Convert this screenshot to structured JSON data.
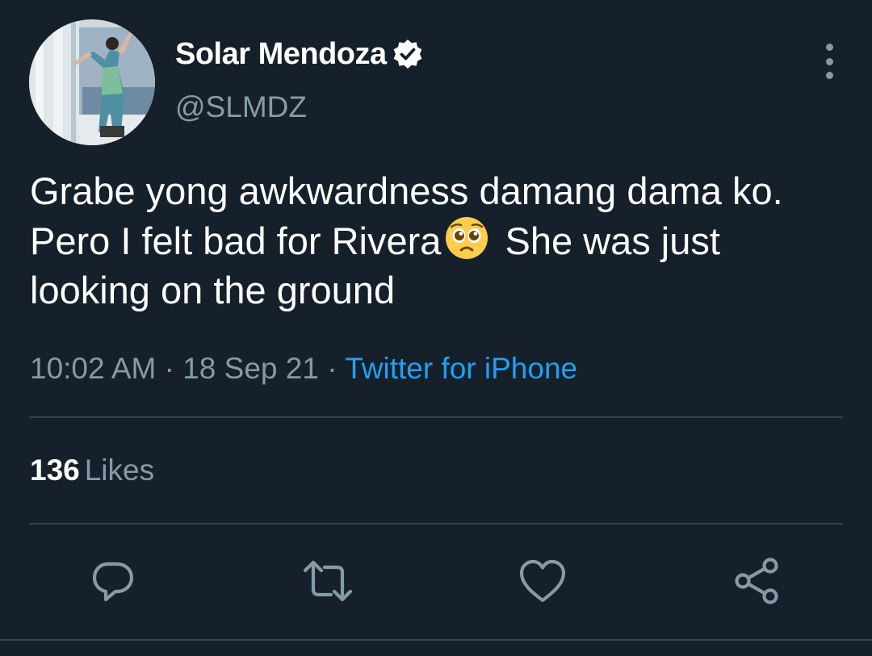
{
  "author": {
    "display_name": "Solar Mendoza",
    "handle": "@SLMDZ",
    "verified": true
  },
  "tweet": {
    "text_before_emoji": "Grabe yong awkwardness damang dama ko. Pero I felt bad for Rivera",
    "emoji": "pleading-face",
    "text_after_emoji": " She was just looking on the ground",
    "time": "10:02 AM",
    "date": "18 Sep 21",
    "separator": "·",
    "source": "Twitter for iPhone"
  },
  "stats": {
    "likes_count": "136",
    "likes_label": "Likes"
  },
  "actions": [
    {
      "name": "reply",
      "icon": "reply-icon"
    },
    {
      "name": "retweet",
      "icon": "retweet-icon"
    },
    {
      "name": "like",
      "icon": "heart-icon"
    },
    {
      "name": "share",
      "icon": "share-icon"
    }
  ],
  "colors": {
    "background": "#15202b",
    "text": "#ffffff",
    "secondary_text": "#8899a6",
    "link": "#1da1f2",
    "divider": "#38444d"
  }
}
